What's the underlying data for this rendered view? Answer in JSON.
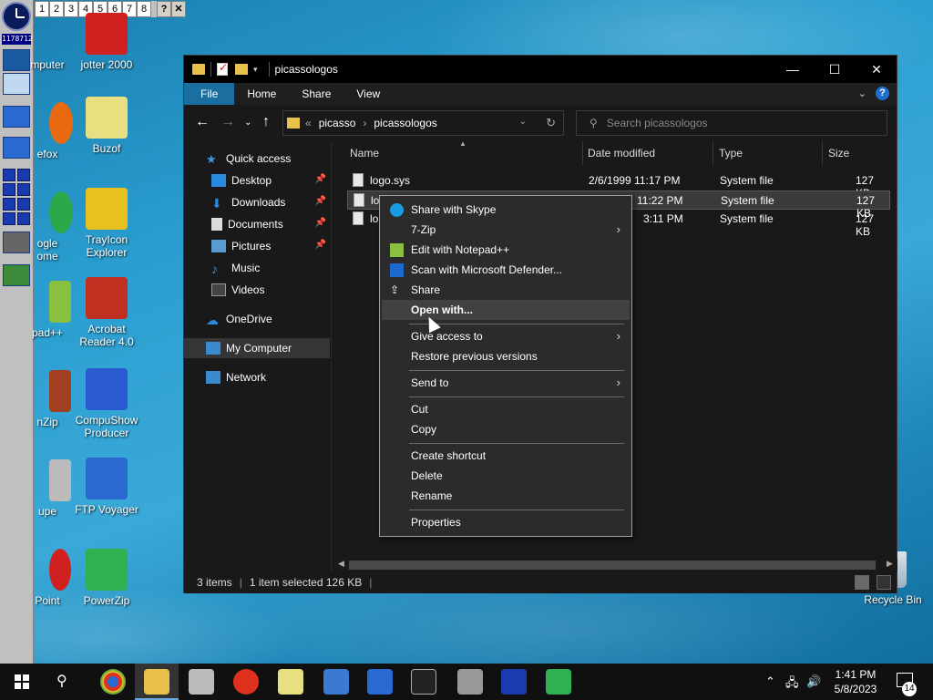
{
  "toolbar": {
    "numbers": [
      "1",
      "2",
      "3",
      "4",
      "5",
      "6",
      "7",
      "8"
    ],
    "help": "?",
    "close": "✕",
    "counter": "1178712"
  },
  "desktop_icons": [
    {
      "label": "mputer",
      "color": "#3a7ad0"
    },
    {
      "label": "jotter 2000",
      "color": "#d02020"
    },
    {
      "label": "efox",
      "color": "#e86a10"
    },
    {
      "label": "Buzof",
      "color": "#e8e080"
    },
    {
      "label": "ogle\nome",
      "color": "#2aa84a"
    },
    {
      "label": "TrayIcon\nExplorer",
      "color": "#e8c020"
    },
    {
      "label": "pad++",
      "color": "#8ac040"
    },
    {
      "label": "Acrobat\nReader 4.0",
      "color": "#c03020"
    },
    {
      "label": "nZip",
      "color": "#a04020"
    },
    {
      "label": "CompuShow\nProducer",
      "color": "#2a5ad0"
    },
    {
      "label": "upe",
      "color": "#bbbbbb"
    },
    {
      "label": "FTP Voyager",
      "color": "#2a6ad0"
    },
    {
      "label": "Point",
      "color": "#d02020"
    },
    {
      "label": "PowerZip",
      "color": "#30b050"
    }
  ],
  "recycle_bin": {
    "label": "Recycle Bin"
  },
  "explorer": {
    "title": "picassologos",
    "ribbon_tabs": [
      "File",
      "Home",
      "Share",
      "View"
    ],
    "address": {
      "root_chevron": "«",
      "crumbs": [
        "picasso",
        "picassologos"
      ]
    },
    "search_placeholder": "Search picassologos",
    "nav": {
      "quick_access": "Quick access",
      "desktop": "Desktop",
      "downloads": "Downloads",
      "documents": "Documents",
      "pictures": "Pictures",
      "music": "Music",
      "videos": "Videos",
      "onedrive": "OneDrive",
      "my_computer": "My Computer",
      "network": "Network"
    },
    "columns": {
      "name": "Name",
      "date": "Date modified",
      "type": "Type",
      "size": "Size"
    },
    "files": [
      {
        "name": "logo.sys",
        "date": "2/6/1999 11:17 PM",
        "type": "System file",
        "size": "127 KB"
      },
      {
        "name": "lo",
        "date": "11:22 PM",
        "type": "System file",
        "size": "127 KB"
      },
      {
        "name": "lo",
        "date": "3:11 PM",
        "type": "System file",
        "size": "127 KB"
      }
    ],
    "status": {
      "items": "3 items",
      "selected": "1 item selected  126 KB"
    }
  },
  "context_menu": {
    "share_skype": "Share with Skype",
    "seven_zip": "7-Zip",
    "notepad": "Edit with Notepad++",
    "defender": "Scan with Microsoft Defender...",
    "share": "Share",
    "open_with": "Open with...",
    "give_access": "Give access to",
    "restore": "Restore previous versions",
    "send_to": "Send to",
    "cut": "Cut",
    "copy": "Copy",
    "create_shortcut": "Create shortcut",
    "delete": "Delete",
    "rename": "Rename",
    "properties": "Properties",
    "submenu_arrow": "›"
  },
  "taskbar": {
    "time": "1:41 PM",
    "date": "5/8/2023",
    "notification_count": "14"
  }
}
